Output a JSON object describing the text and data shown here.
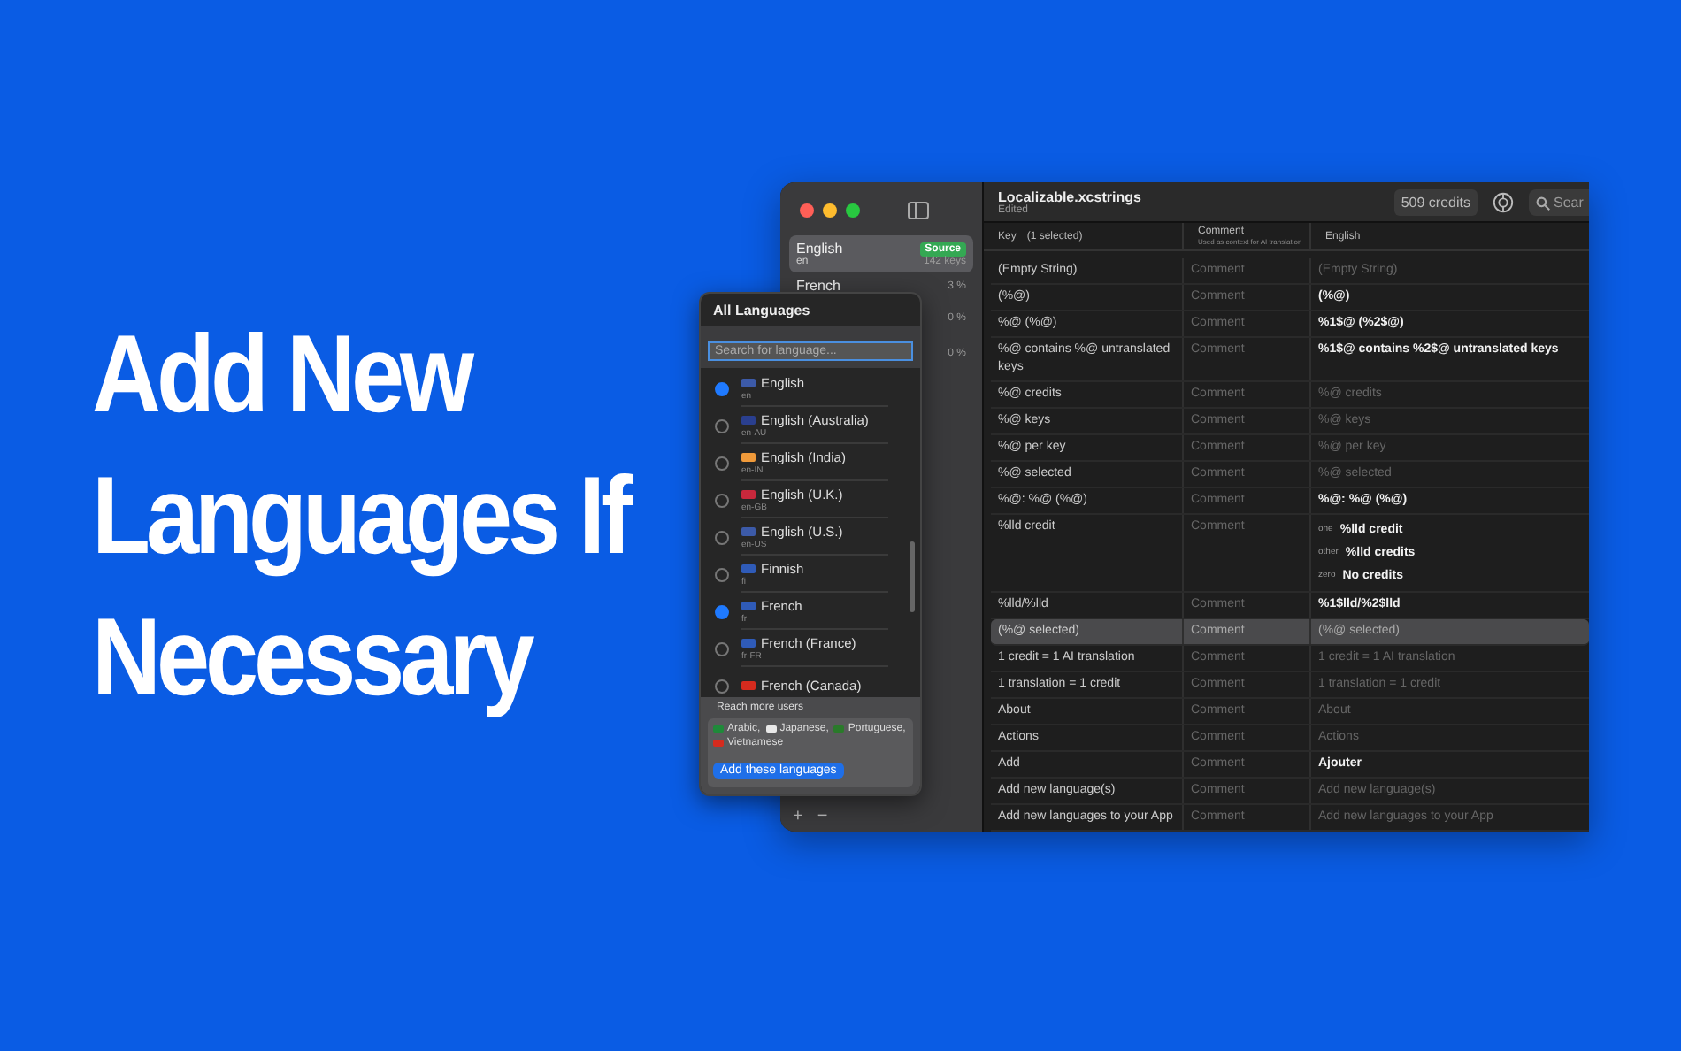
{
  "headline": [
    "Add New",
    "Languages If",
    "Necessary"
  ],
  "sidebar": {
    "items": [
      {
        "name": "English",
        "code": "en",
        "badge": "Source",
        "count": "142 keys",
        "selected": true
      },
      {
        "name": "French",
        "percent": "3 %",
        "selected": false
      },
      {
        "percent": "0 %",
        "selected": false
      },
      {
        "percent": "0 %",
        "selected": false
      }
    ]
  },
  "document": {
    "title": "Localizable.xcstrings",
    "subtitle": "Edited",
    "credits": "509 credits",
    "search": {
      "placeholder": "Sear"
    }
  },
  "table": {
    "columns": [
      {
        "title": "Key",
        "note": "(1 selected)"
      },
      {
        "title": "Comment",
        "note": "Used as context for AI translation"
      },
      {
        "title": "English"
      }
    ],
    "rows": [
      {
        "key": "(Empty String)",
        "comment": "Comment",
        "value": "(Empty String)",
        "translated": false,
        "selected": false
      },
      {
        "key": " (%@)",
        "comment": "Comment",
        "value": " (%@)",
        "translated": true,
        "selected": false
      },
      {
        "key": "%@ (%@)",
        "comment": "Comment",
        "value": "%1$@ (%2$@)",
        "translated": true,
        "selected": false
      },
      {
        "key": "%@ contains %@ untranslated keys",
        "comment": "Comment",
        "value": "%1$@ contains %2$@ untranslated keys",
        "translated": true,
        "selected": false
      },
      {
        "key": "%@ credits",
        "comment": "Comment",
        "value": "%@ credits",
        "translated": false,
        "selected": false
      },
      {
        "key": "%@ keys",
        "comment": "Comment",
        "value": "%@ keys",
        "translated": false,
        "selected": false
      },
      {
        "key": "%@ per key",
        "comment": "Comment",
        "value": "%@ per key",
        "translated": false,
        "selected": false
      },
      {
        "key": "%@ selected",
        "comment": "Comment",
        "value": "%@ selected",
        "translated": false,
        "selected": false
      },
      {
        "key": "%@: %@ (%@)",
        "comment": "Comment",
        "value": "%@: %@ (%@)",
        "translated": true,
        "selected": false
      },
      {
        "key": "%lld credit",
        "comment": "Comment",
        "variants": [
          {
            "label": "one",
            "value": "%lld credit"
          },
          {
            "label": "other",
            "value": "%lld credits"
          },
          {
            "label": "zero",
            "value": "No credits"
          }
        ],
        "translated": true,
        "selected": false
      },
      {
        "key": "%lld/%lld",
        "comment": "Comment",
        "value": "%1$lld/%2$lld",
        "translated": true,
        "selected": false
      },
      {
        "key": "(%@ selected)",
        "comment": "Comment",
        "value": "(%@ selected)",
        "translated": false,
        "selected": true
      },
      {
        "key": "1 credit = 1 AI translation",
        "comment": "Comment",
        "value": "1 credit = 1 AI translation",
        "translated": false,
        "selected": false
      },
      {
        "key": "1 translation = 1 credit",
        "comment": "Comment",
        "value": "1 translation = 1 credit",
        "translated": false,
        "selected": false
      },
      {
        "key": "About",
        "comment": "Comment",
        "value": "About",
        "translated": false,
        "selected": false
      },
      {
        "key": "Actions",
        "comment": "Comment",
        "value": "Actions",
        "translated": false,
        "selected": false
      },
      {
        "key": "Add",
        "comment": "Comment",
        "value": "Ajouter",
        "translated": true,
        "selected": false
      },
      {
        "key": "Add new language(s)",
        "comment": "Comment",
        "value": "Add new language(s)",
        "translated": false,
        "selected": false
      },
      {
        "key": "Add new languages to your App",
        "comment": "Comment",
        "value": "Add new languages to your App",
        "translated": false,
        "selected": false
      }
    ]
  },
  "popover": {
    "title": "All Languages",
    "search": {
      "placeholder": "Search for language..."
    },
    "languages": [
      {
        "name": "English",
        "code": "en",
        "color": "#3c5aa8",
        "selected": true
      },
      {
        "name": "English (Australia)",
        "code": "en-AU",
        "color": "#2a3f8f",
        "selected": false
      },
      {
        "name": "English (India)",
        "code": "en-IN",
        "color": "#f09a3a",
        "selected": false
      },
      {
        "name": "English (U.K.)",
        "code": "en-GB",
        "color": "#c8283c",
        "selected": false
      },
      {
        "name": "English (U.S.)",
        "code": "en-US",
        "color": "#3c5aa8",
        "selected": false
      },
      {
        "name": "Finnish",
        "code": "fi",
        "color": "#2f5bb8",
        "selected": false
      },
      {
        "name": "French",
        "code": "fr",
        "color": "#2f5bb8",
        "selected": true
      },
      {
        "name": "French (France)",
        "code": "fr-FR",
        "color": "#2f5bb8",
        "selected": false
      },
      {
        "name": "French (Canada)",
        "color": "#d52b1e",
        "selected": false
      }
    ],
    "suggestion": {
      "title": "Reach more users",
      "languages": [
        {
          "name": "Arabic,",
          "color": "#1f8a3a"
        },
        {
          "name": "Japanese,",
          "color": "#e8e8e8"
        },
        {
          "name": "Portuguese,",
          "color": "#2a7a2a"
        },
        {
          "name": "Vietnamese",
          "color": "#d52b1e"
        }
      ],
      "button": "Add these languages"
    }
  },
  "footer_buttons": [
    "+",
    "−"
  ]
}
